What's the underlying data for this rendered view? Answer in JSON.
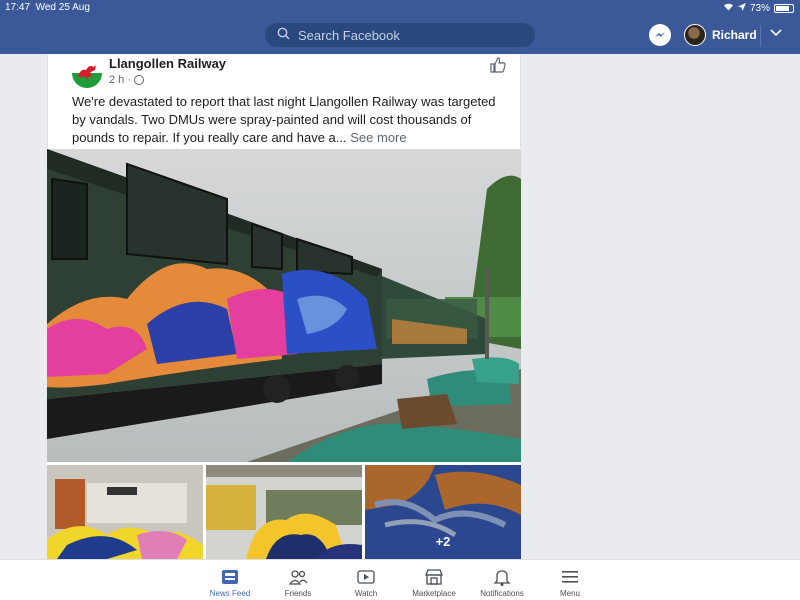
{
  "status_bar": {
    "time": "17:47",
    "date": "Wed 25 Aug",
    "battery": "73%"
  },
  "header": {
    "search_placeholder": "Search Facebook",
    "user_name": "Richard",
    "icons": [
      "search-icon",
      "messenger-icon",
      "chevron-down-icon"
    ]
  },
  "post": {
    "author": "Llangollen Railway",
    "time": "2 h",
    "text": "We're devastated to report that last night Llangollen Railway was targeted by vandals. Two DMUs were spray-painted and will cost thousands of pounds to repair.  If you really care and have a...",
    "see_more": "See more",
    "extra_photos": "+2"
  },
  "tabbar": {
    "items": [
      {
        "label": "News Feed",
        "icon": "news-feed-icon",
        "active": true
      },
      {
        "label": "Friends",
        "icon": "friends-icon",
        "active": false
      },
      {
        "label": "Watch",
        "icon": "watch-icon",
        "active": false
      },
      {
        "label": "Marketplace",
        "icon": "marketplace-icon",
        "active": false
      },
      {
        "label": "Notifications",
        "icon": "bell-icon",
        "active": false
      },
      {
        "label": "Menu",
        "icon": "hamburger-icon",
        "active": false
      }
    ]
  },
  "colors": {
    "header_bg": "#3b5998",
    "active_tab": "#4267b2"
  }
}
